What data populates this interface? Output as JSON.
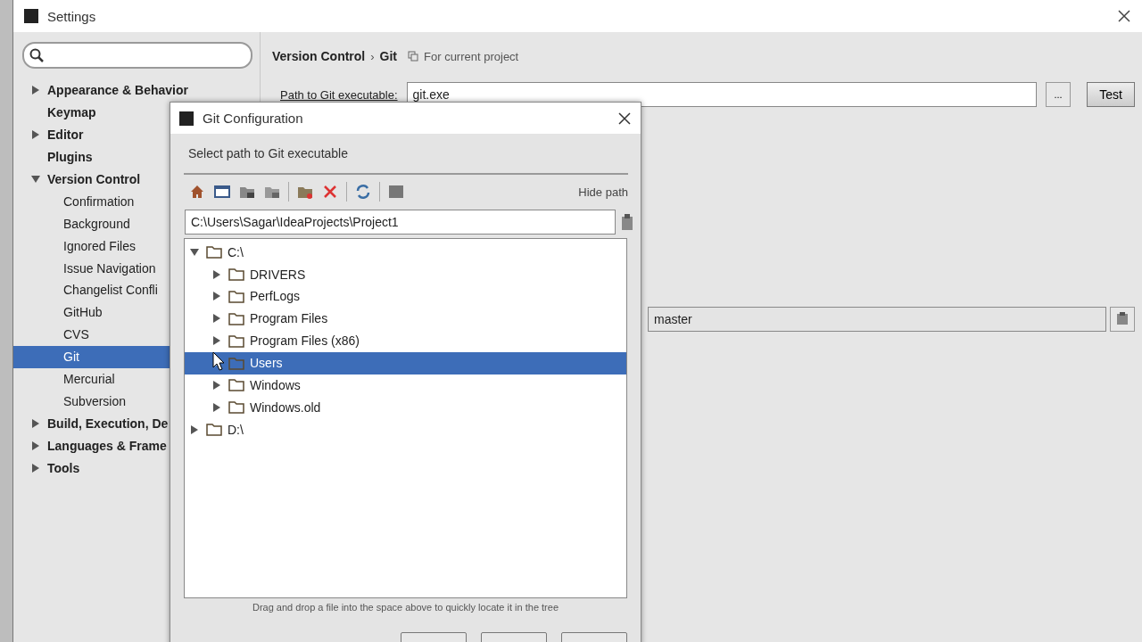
{
  "window": {
    "title": "Settings"
  },
  "sidebar": {
    "items": [
      {
        "kind": "group",
        "label": "Appearance & Behavior",
        "expanded": false,
        "selected": false
      },
      {
        "kind": "leaf",
        "label": "Keymap",
        "selected": false
      },
      {
        "kind": "group",
        "label": "Editor",
        "expanded": false,
        "selected": false
      },
      {
        "kind": "leaf",
        "label": "Plugins",
        "selected": false
      },
      {
        "kind": "group",
        "label": "Version Control",
        "expanded": true,
        "selected": false,
        "children": [
          {
            "label": "Confirmation",
            "selected": false
          },
          {
            "label": "Background",
            "selected": false
          },
          {
            "label": "Ignored Files",
            "selected": false
          },
          {
            "label": "Issue Navigation",
            "selected": false
          },
          {
            "label": "Changelist Confli",
            "selected": false
          },
          {
            "label": "GitHub",
            "selected": false
          },
          {
            "label": "CVS",
            "selected": false
          },
          {
            "label": "Git",
            "selected": true
          },
          {
            "label": "Mercurial",
            "selected": false
          },
          {
            "label": "Subversion",
            "selected": false
          }
        ]
      },
      {
        "kind": "group",
        "label": "Build, Execution, De",
        "expanded": false,
        "selected": false
      },
      {
        "kind": "group",
        "label": "Languages & Frame",
        "expanded": false,
        "selected": false
      },
      {
        "kind": "group",
        "label": "Tools",
        "expanded": false,
        "selected": false
      }
    ]
  },
  "breadcrumb": {
    "parent": "Version Control",
    "separator": "›",
    "current": "Git",
    "scope": "For current project"
  },
  "git_path": {
    "label": "Path to Git executable:",
    "value": "git.exe",
    "browse": "...",
    "test": "Test"
  },
  "branch_field": {
    "value": "master"
  },
  "dialog": {
    "title": "Git Configuration",
    "subtitle": "Select path to Git executable",
    "hide_path": "Hide path",
    "path": "C:\\Users\\Sagar\\IdeaProjects\\Project1",
    "tree": [
      {
        "label": "C:\\",
        "expanded": true,
        "selected": false,
        "children": [
          {
            "label": "DRIVERS",
            "expanded": false,
            "selected": false
          },
          {
            "label": "PerfLogs",
            "expanded": false,
            "selected": false
          },
          {
            "label": "Program Files",
            "expanded": false,
            "selected": false
          },
          {
            "label": "Program Files (x86)",
            "expanded": false,
            "selected": false
          },
          {
            "label": "Users",
            "expanded": false,
            "selected": true
          },
          {
            "label": "Windows",
            "expanded": false,
            "selected": false
          },
          {
            "label": "Windows.old",
            "expanded": false,
            "selected": false
          }
        ]
      },
      {
        "label": "D:\\",
        "expanded": false,
        "selected": false
      }
    ],
    "hint": "Drag and drop a file into the space above to quickly locate it in the tree"
  }
}
